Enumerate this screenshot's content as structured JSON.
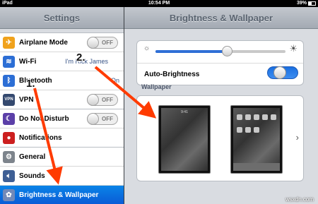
{
  "status": {
    "carrier": "iPad",
    "time": "10:54 PM",
    "battery": "39%"
  },
  "left": {
    "title": "Settings",
    "rows": [
      {
        "label": "Airplane Mode",
        "toggle": "OFF"
      },
      {
        "label": "Wi-Fi",
        "value": "I'm Rick James"
      },
      {
        "label": "Bluetooth",
        "value": "On"
      },
      {
        "label": "VPN",
        "toggle": "OFF"
      },
      {
        "label": "Do Not Disturb",
        "toggle": "OFF"
      },
      {
        "label": "Notifications"
      },
      {
        "label": "General"
      },
      {
        "label": "Sounds"
      },
      {
        "label": "Brightness & Wallpaper"
      }
    ]
  },
  "right": {
    "title": "Brightness & Wallpaper",
    "brightness_level": 0.55,
    "auto_label": "Auto-Brightness",
    "auto_toggle": "ON",
    "wallpaper_header": "Wallpaper",
    "lock_clock": "9:41"
  },
  "annotations": {
    "step1": "1.",
    "step2": "2."
  },
  "watermark": "wsxdn.com",
  "colors": {
    "accent": "#0a6ee0",
    "arrow": "#ff3b00"
  }
}
